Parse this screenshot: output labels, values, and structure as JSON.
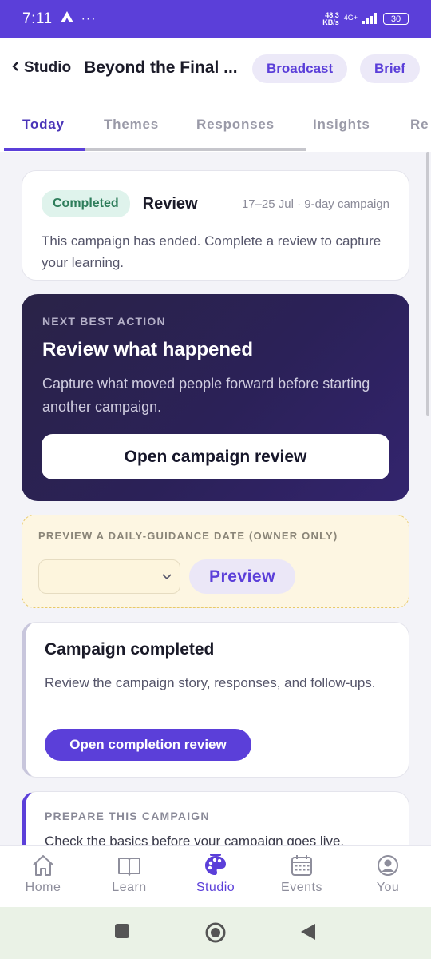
{
  "status_bar": {
    "time": "7:11",
    "net_speed_value": "48.3",
    "net_speed_unit": "KB/s",
    "network": "4G+",
    "battery": "30"
  },
  "header": {
    "back_label": "Studio",
    "title": "Beyond the Final ...",
    "broadcast_label": "Broadcast",
    "brief_label": "Brief"
  },
  "tabs": [
    {
      "label": "Today",
      "active": true
    },
    {
      "label": "Themes",
      "active": false
    },
    {
      "label": "Responses",
      "active": false
    },
    {
      "label": "Insights",
      "active": false
    },
    {
      "label": "Re",
      "active": false
    }
  ],
  "status_card": {
    "badge": "Completed",
    "title": "Review",
    "dates": "17–25 Jul · 9-day campaign",
    "description": "This campaign has ended. Complete a review to capture your learning."
  },
  "next_action": {
    "eyebrow": "NEXT BEST ACTION",
    "title": "Review what happened",
    "description": "Capture what moved people forward before starting another campaign.",
    "button": "Open campaign review"
  },
  "preview": {
    "eyebrow": "PREVIEW A DAILY-GUIDANCE DATE (OWNER ONLY)",
    "selected_date": "",
    "button": "Preview"
  },
  "completed_card": {
    "title": "Campaign completed",
    "description": "Review the campaign story, responses, and follow-ups.",
    "button": "Open completion review"
  },
  "prepare_card": {
    "eyebrow": "PREPARE THIS CAMPAIGN",
    "description": "Check the basics before your campaign goes live."
  },
  "bottom_nav": [
    {
      "label": "Home",
      "icon": "home-icon",
      "active": false
    },
    {
      "label": "Learn",
      "icon": "book-icon",
      "active": false
    },
    {
      "label": "Studio",
      "icon": "palette-icon",
      "active": true
    },
    {
      "label": "Events",
      "icon": "calendar-icon",
      "active": false
    },
    {
      "label": "You",
      "icon": "user-icon",
      "active": false
    }
  ],
  "colors": {
    "accent": "#5b3fd9",
    "status_bar": "#5b3fd9",
    "completed_badge": "#2e7d5b",
    "preview_bg": "#fdf6e2",
    "action_card": "#2a2347"
  }
}
